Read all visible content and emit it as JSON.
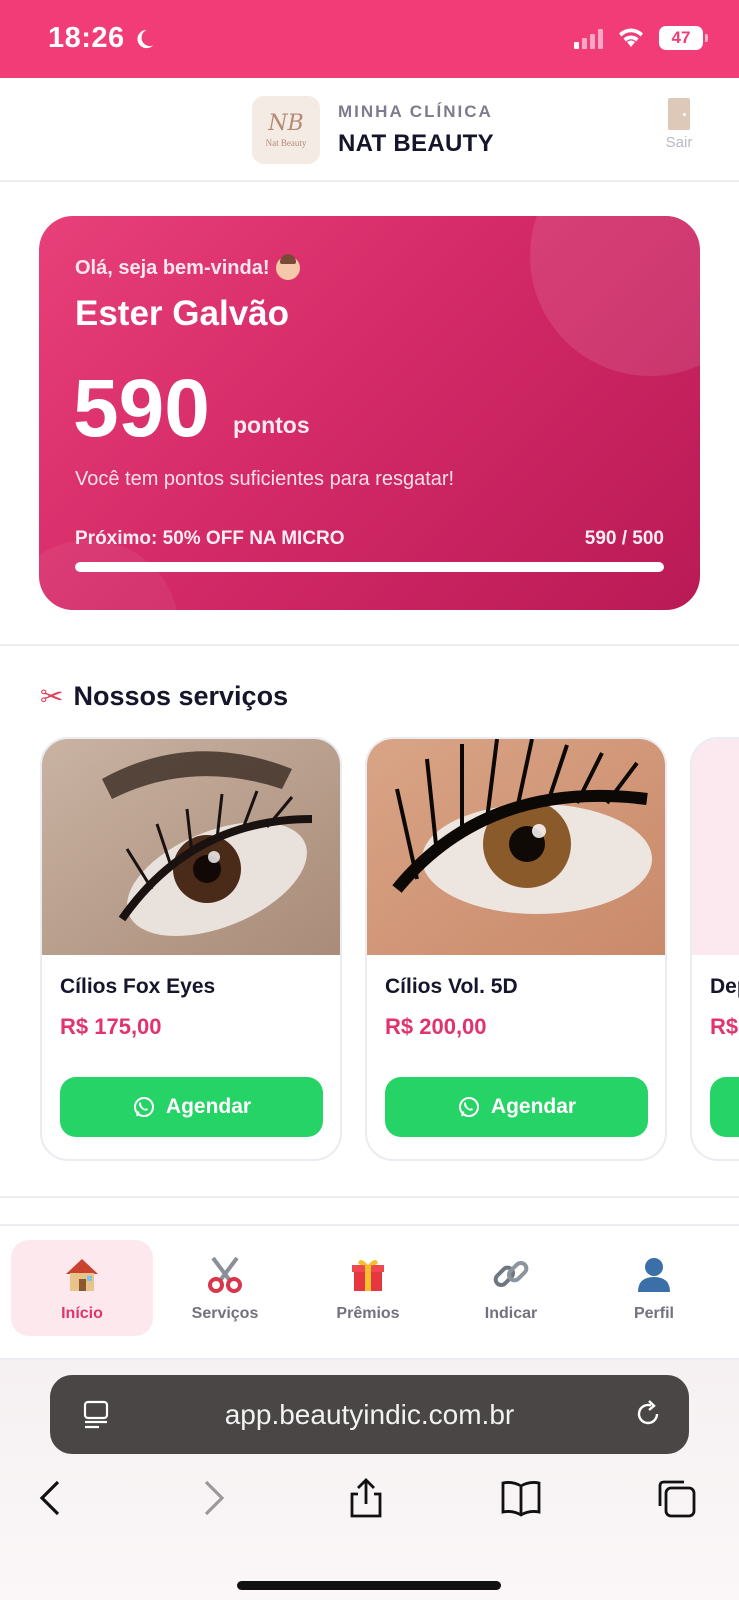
{
  "status_bar": {
    "time": "18:26",
    "battery": "47"
  },
  "header": {
    "kicker": "MINHA CLÍNICA",
    "clinic_name": "NAT BEAUTY",
    "logo_text": "Nat Beauty",
    "logo_monogram": "NB",
    "exit_label": "Sair"
  },
  "points_card": {
    "greeting": "Olá, seja bem-vinda!",
    "user_name": "Ester Galvão",
    "points": "590",
    "points_unit": "pontos",
    "message": "Você tem pontos suficientes para resgatar!",
    "next_reward": "Próximo: 50% OFF NA MICRO",
    "progress_text": "590 / 500",
    "progress_fraction": 1.0
  },
  "services": {
    "title": "Nossos serviços",
    "items": [
      {
        "name": "Cílios Fox Eyes",
        "price": "R$ 175,00",
        "button": "Agendar"
      },
      {
        "name": "Cílios Vol. 5D",
        "price": "R$ 200,00",
        "button": "Agendar"
      },
      {
        "name": "Dep",
        "price": "R$",
        "button": ""
      }
    ]
  },
  "nav": {
    "items": [
      {
        "label": "Início",
        "icon": "house-icon",
        "active": true
      },
      {
        "label": "Serviços",
        "icon": "scissors-icon",
        "active": false
      },
      {
        "label": "Prêmios",
        "icon": "gift-icon",
        "active": false
      },
      {
        "label": "Indicar",
        "icon": "link-icon",
        "active": false
      },
      {
        "label": "Perfil",
        "icon": "person-icon",
        "active": false
      }
    ]
  },
  "browser": {
    "url": "app.beautyindic.com.br"
  },
  "colors": {
    "brand_pink": "#f23c78",
    "card_pink": "#d42a68",
    "price_pink": "#e2336d",
    "whatsapp_green": "#25d366"
  }
}
